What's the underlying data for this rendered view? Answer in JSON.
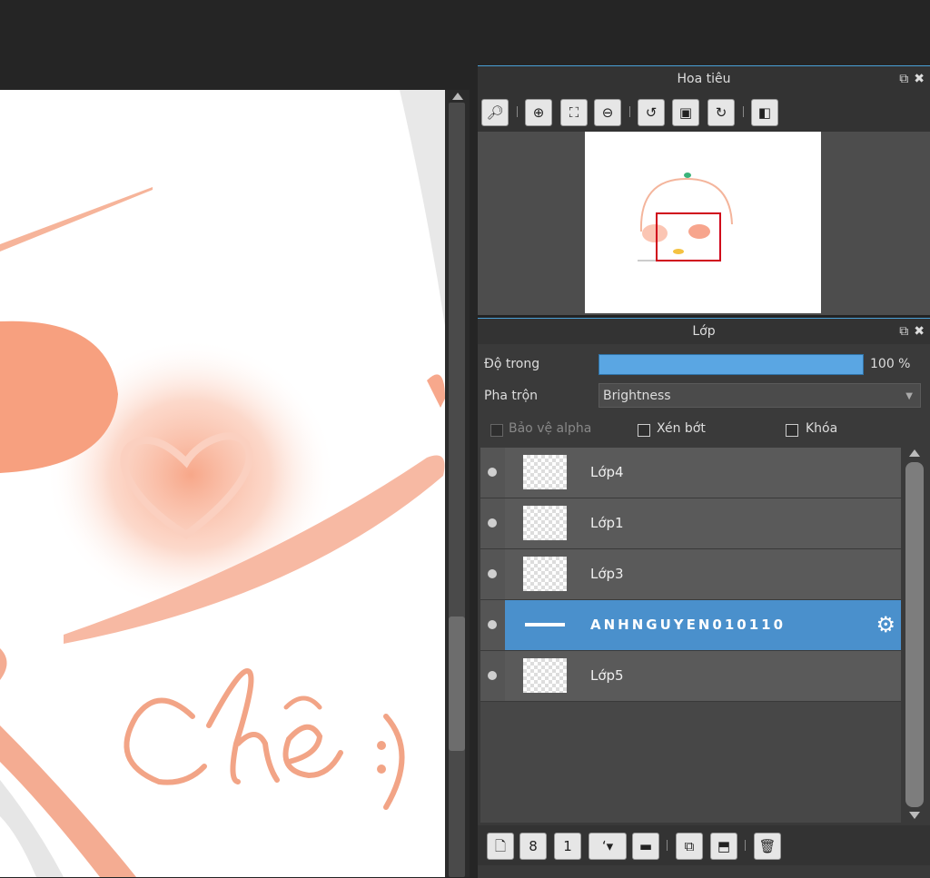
{
  "navigator": {
    "title": "Hoa tiêu",
    "tools": [
      "zoom-actual-icon",
      "zoom-in-icon",
      "fit-window-icon",
      "zoom-out-icon",
      "rotate-left-icon",
      "reset-rotation-icon",
      "rotate-right-icon",
      "flip-horizontal-icon"
    ]
  },
  "layers_panel": {
    "title": "Lớp",
    "opacity_label": "Độ trong",
    "opacity_value": "100 %",
    "opacity_level": 1.0,
    "blend_label": "Pha trộn",
    "blend_mode": "Brightness",
    "protect_alpha": "Bảo vệ alpha",
    "clipping": "Xén bớt",
    "lock": "Khóa",
    "layers": [
      {
        "name": "Lớp4",
        "selected": false
      },
      {
        "name": "Lớp1",
        "selected": false
      },
      {
        "name": "Lớp3",
        "selected": false
      },
      {
        "name": "ANHNGUYEN010110",
        "selected": true
      },
      {
        "name": "Lớp5",
        "selected": false
      }
    ]
  },
  "colors": {
    "accent": "#4a90cc",
    "artwork": "#f4a888"
  }
}
